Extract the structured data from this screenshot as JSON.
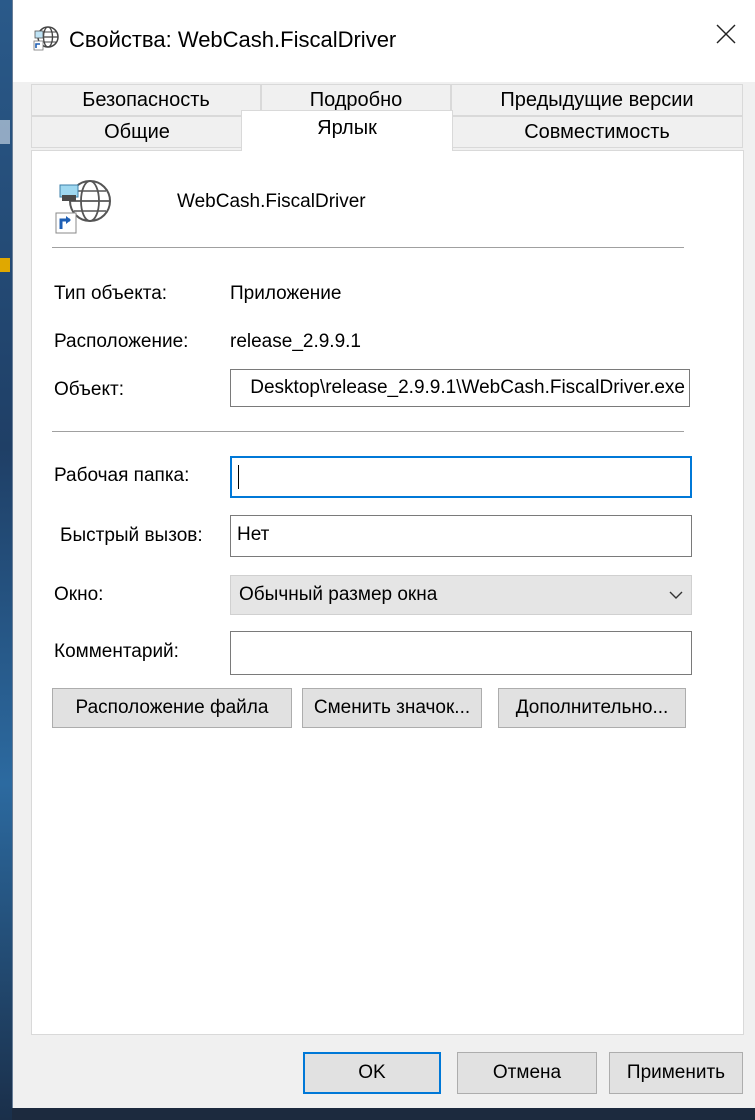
{
  "window": {
    "title": "Свойства: WebCash.FiscalDriver",
    "close_icon": "close-icon",
    "app_icon": "globe-shortcut-icon"
  },
  "tabs": {
    "row_top": [
      "Безопасность",
      "Подробно",
      "Предыдущие версии"
    ],
    "row_bottom": [
      "Общие",
      "Ярлык",
      "Совместимость"
    ],
    "active": "Ярлык"
  },
  "shortcut": {
    "name": "WebCash.FiscalDriver",
    "type_label": "Тип объекта:",
    "type_value": "Приложение",
    "location_label": "Расположение:",
    "location_value": "release_2.9.9.1",
    "target_label": "Объект:",
    "target_value": "Desktop\\release_2.9.9.1\\WebCash.FiscalDriver.exe",
    "workdir_label": "Рабочая папка:",
    "workdir_value": "",
    "hotkey_label": "Быстрый вызов:",
    "hotkey_value": "Нет",
    "window_label": "Окно:",
    "window_value": "Обычный размер окна",
    "comment_label": "Комментарий:",
    "comment_value": ""
  },
  "actions": {
    "open_location": "Расположение файла",
    "change_icon": "Сменить значок...",
    "advanced": "Дополнительно..."
  },
  "footer": {
    "ok": "OK",
    "cancel": "Отмена",
    "apply": "Применить"
  },
  "colors": {
    "accent": "#0078d7",
    "window_bg": "#f0f0f0",
    "panel_bg": "#ffffff"
  }
}
